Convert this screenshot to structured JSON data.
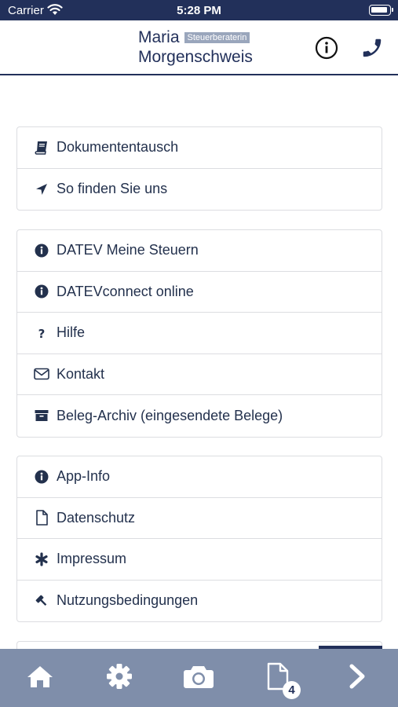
{
  "status_bar": {
    "carrier": "Carrier",
    "time": "5:28 PM"
  },
  "header": {
    "first_name": "Maria",
    "badge": "Steuerberaterin",
    "last_name": "Morgenschweis",
    "info_icon": "info-circle-icon",
    "phone_icon": "phone-icon"
  },
  "menu": {
    "groups": [
      {
        "items": [
          {
            "label": "Dokumententausch",
            "icon": "book-icon"
          },
          {
            "label": "So finden Sie uns",
            "icon": "location-arrow-icon"
          }
        ]
      },
      {
        "items": [
          {
            "label": "DATEV Meine Steuern",
            "icon": "info-circle-icon"
          },
          {
            "label": "DATEVconnect online",
            "icon": "info-circle-icon"
          },
          {
            "label": "Hilfe",
            "icon": "question-icon"
          },
          {
            "label": "Kontakt",
            "icon": "envelope-icon"
          },
          {
            "label": "Beleg-Archiv (eingesendete Belege)",
            "icon": "archive-icon"
          }
        ]
      },
      {
        "items": [
          {
            "label": "App-Info",
            "icon": "info-circle-icon"
          },
          {
            "label": "Datenschutz",
            "icon": "file-icon"
          },
          {
            "label": "Impressum",
            "icon": "asterisk-icon"
          },
          {
            "label": "Nutzungsbedingungen",
            "icon": "gavel-icon"
          }
        ]
      }
    ]
  },
  "tab_bar": {
    "tabs": [
      {
        "icon": "home-icon"
      },
      {
        "icon": "gear-icon"
      },
      {
        "icon": "camera-icon"
      },
      {
        "icon": "document-icon",
        "badge": "4"
      },
      {
        "icon": "chevron-right-icon"
      }
    ]
  },
  "colors": {
    "navy": "#22305a",
    "tab_bar": "#7f8eaa",
    "border": "#dcdde1",
    "text": "#23314d"
  }
}
